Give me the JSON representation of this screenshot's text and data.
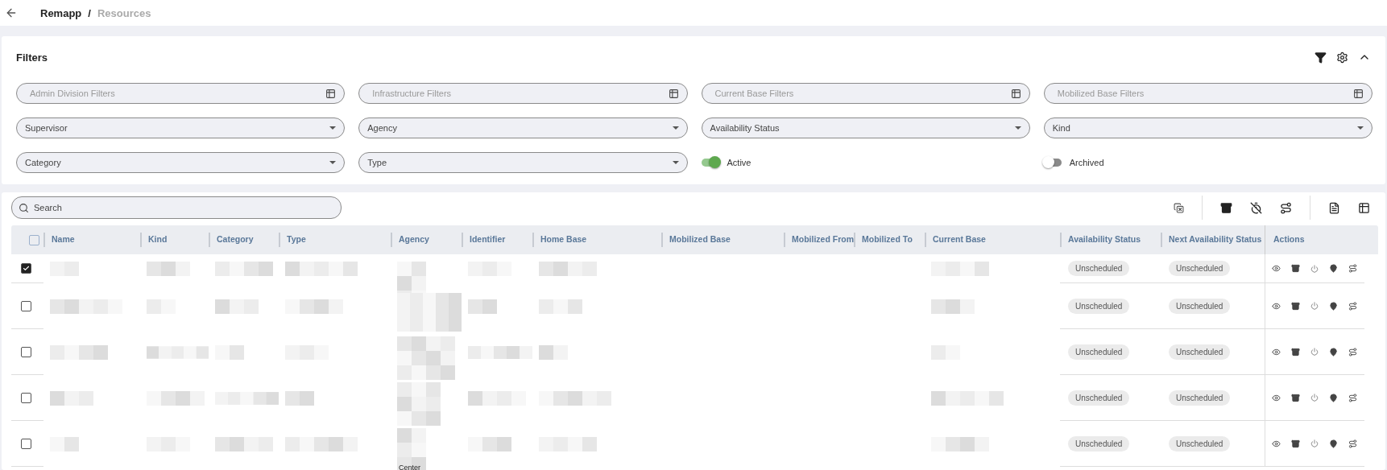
{
  "breadcrumb": {
    "root": "Remapp",
    "separator": "/",
    "current": "Resources"
  },
  "filters": {
    "title": "Filters",
    "items": [
      {
        "kind": "tree",
        "placeholder": "Admin Division Filters"
      },
      {
        "kind": "tree",
        "placeholder": "Infrastructure Filters"
      },
      {
        "kind": "tree",
        "placeholder": "Current Base Filters"
      },
      {
        "kind": "tree",
        "placeholder": "Mobilized Base Filters"
      },
      {
        "kind": "select",
        "value": "Supervisor"
      },
      {
        "kind": "select",
        "value": "Agency"
      },
      {
        "kind": "select",
        "value": "Availability Status"
      },
      {
        "kind": "select",
        "value": "Kind"
      },
      {
        "kind": "select",
        "value": "Category"
      },
      {
        "kind": "select",
        "value": "Type"
      },
      {
        "kind": "toggle",
        "label": "Active",
        "on": true
      },
      {
        "kind": "toggle",
        "label": "Archived",
        "on": false
      }
    ]
  },
  "search": {
    "placeholder": "Search"
  },
  "table": {
    "header_checked": false,
    "columns": [
      "Name",
      "Kind",
      "Category",
      "Type",
      "Agency",
      "Identifier",
      "Home Base",
      "Mobilized Base",
      "Mobilized From",
      "Mobilized To",
      "Current Base",
      "Availability Status",
      "Next Availability Status",
      "Actions"
    ],
    "rows": [
      {
        "selected": true,
        "availability": "Unscheduled",
        "next_availability": "Unscheduled"
      },
      {
        "selected": false,
        "availability": "Unscheduled",
        "next_availability": "Unscheduled"
      },
      {
        "selected": false,
        "availability": "Unscheduled",
        "next_availability": "Unscheduled"
      },
      {
        "selected": false,
        "availability": "Unscheduled",
        "next_availability": "Unscheduled"
      },
      {
        "selected": false,
        "availability": "Unscheduled",
        "next_availability": "Unscheduled",
        "agency": "Center"
      }
    ]
  }
}
